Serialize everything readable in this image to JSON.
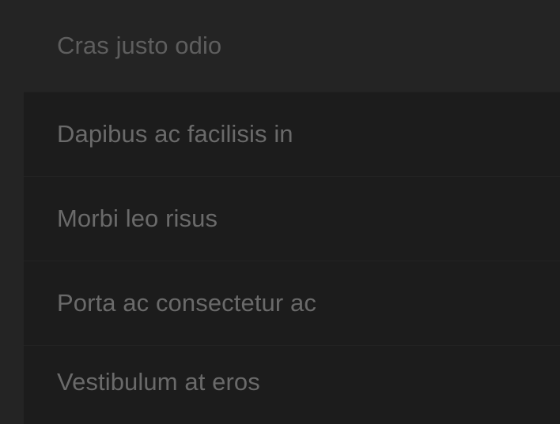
{
  "list": {
    "items": [
      {
        "label": "Cras justo odio"
      },
      {
        "label": "Dapibus ac facilisis in"
      },
      {
        "label": "Morbi leo risus"
      },
      {
        "label": "Porta ac consectetur ac"
      },
      {
        "label": "Vestibulum at eros"
      }
    ]
  },
  "colors": {
    "page_background": "#242424",
    "item_background": "#1c1c1c",
    "item_text": "#6a6a6a"
  }
}
